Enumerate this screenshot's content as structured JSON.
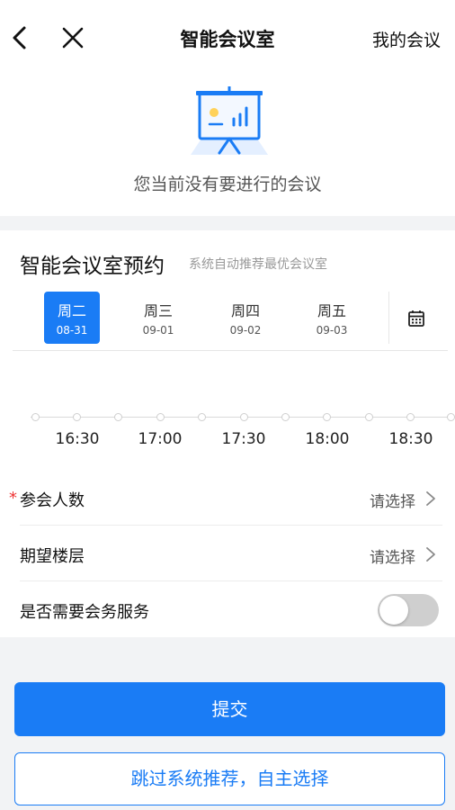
{
  "header": {
    "title": "智能会议室",
    "right_link": "我的会议",
    "back_icon": "back-arrow-icon",
    "close_icon": "close-icon"
  },
  "empty_state": {
    "icon": "presentation-board-icon",
    "text": "您当前没有要进行的会议"
  },
  "booking": {
    "title": "智能会议室预约",
    "subtitle": "系统自动推荐最优会议室",
    "days": [
      {
        "weekday": "周二",
        "date": "08-31",
        "selected": true
      },
      {
        "weekday": "周三",
        "date": "09-01",
        "selected": false
      },
      {
        "weekday": "周四",
        "date": "09-02",
        "selected": false
      },
      {
        "weekday": "周五",
        "date": "09-03",
        "selected": false
      }
    ],
    "calendar_icon": "calendar-icon",
    "timeline": {
      "labels": [
        "16:30",
        "17:00",
        "17:30",
        "18:00",
        "18:30"
      ]
    }
  },
  "form": {
    "attendees": {
      "label": "参会人数",
      "required_mark": "*",
      "value": "请选择"
    },
    "floor": {
      "label": "期望楼层",
      "value": "请选择"
    },
    "service": {
      "label": "是否需要会务服务",
      "enabled": false
    }
  },
  "actions": {
    "submit": "提交",
    "skip": "跳过系统推荐，自主选择"
  },
  "colors": {
    "primary": "#1a7cf5",
    "required": "#ee3333",
    "toggle_off": "#cfcfcf"
  }
}
